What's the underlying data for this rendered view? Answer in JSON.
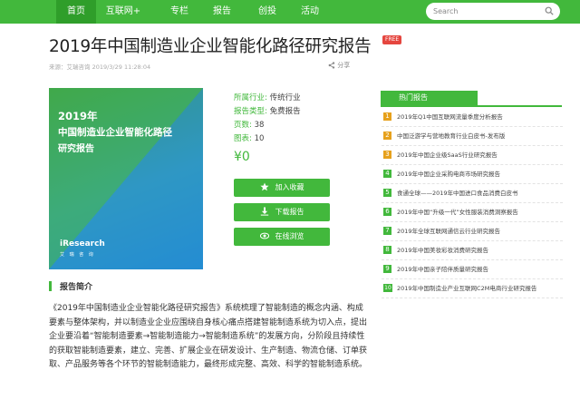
{
  "nav": {
    "items": [
      "首页",
      "互联网+",
      "专栏",
      "报告",
      "创投",
      "活动"
    ],
    "search_placeholder": "Search"
  },
  "article": {
    "title": "2019年中国制造业企业智能化路径研究报告",
    "badge": "FREE",
    "source": "来源：艾瑞咨询 2019/3/29 11:28:04",
    "share": "分享"
  },
  "cover": {
    "line1": "2019年",
    "line2": "中国制造业企业智能化路径",
    "line3": "研究报告",
    "logo": "iResearch",
    "logo_sub": "艾 瑞 咨 询"
  },
  "meta": {
    "industry_label": "所属行业:",
    "industry_value": "传统行业",
    "type_label": "报告类型:",
    "type_value": "免费报告",
    "pages_label": "页数:",
    "pages_value": "38",
    "charts_label": "图表:",
    "charts_value": "10",
    "price": "¥0"
  },
  "actions": {
    "favorite": "加入收藏",
    "download": "下载报告",
    "online": "在线浏览"
  },
  "summary": {
    "title": "报告简介",
    "text": "《2019年中国制造业企业智能化路径研究报告》系统梳理了智能制造的概念内涵、构成要素与整体架构，并以制造业企业应围绕自身核心痛点搭建智能制造系统为切入点，提出企业要沿着“智能制造要素→智能制造能力→智能制造系统”的发展方向，分阶段且持续性的获取智能制造要素，建立、完善、扩展企业在研发设计、生产制造、物流仓储、订单获取、产品服务等各个环节的智能制造能力，最终形成完整、高效、科学的智能制造系统。"
  },
  "hot": {
    "title": "热门报告",
    "items": [
      {
        "num": "1",
        "text": "2019年Q1中国互联网流量季度分析报告"
      },
      {
        "num": "2",
        "text": "中国泛游学与营地教育行业白皮书-发布版"
      },
      {
        "num": "3",
        "text": "2019年中国企业级SaaS行业研究报告"
      },
      {
        "num": "4",
        "text": "2019年中国企业采购电商市场研究报告"
      },
      {
        "num": "5",
        "text": "食通全球——2019年中国进口食品消费白皮书"
      },
      {
        "num": "6",
        "text": "2019年中国“升级一代”女性服装消费洞察报告"
      },
      {
        "num": "7",
        "text": "2019年全球互联网通信云行业研究报告"
      },
      {
        "num": "8",
        "text": "2019年中国美妆彩妆消费研究报告"
      },
      {
        "num": "9",
        "text": "2019年中国亲子陪伴质量研究报告"
      },
      {
        "num": "10",
        "text": "2019年中国制造业产业互联网C2M电商行业研究报告"
      }
    ]
  },
  "colors": {
    "accent": "#42b83c",
    "badge": "#e5463f",
    "rank_top": "#e6a11d",
    "rank_other": "#42b83c"
  }
}
